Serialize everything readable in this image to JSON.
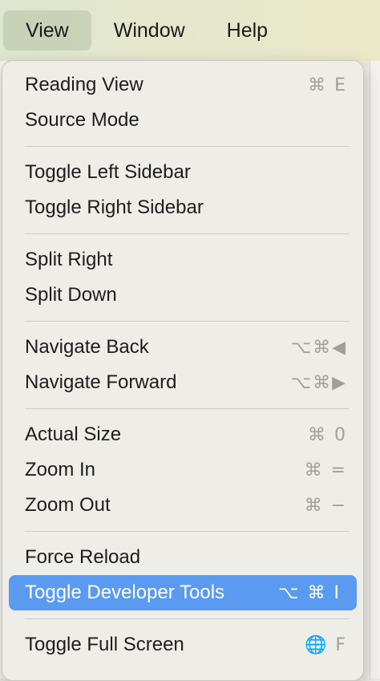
{
  "menubar": {
    "items": [
      {
        "label": "View"
      },
      {
        "label": "Window"
      },
      {
        "label": "Help"
      }
    ]
  },
  "menu": {
    "groups": [
      [
        {
          "label": "Reading View",
          "shortcut": "⌘ E"
        },
        {
          "label": "Source Mode",
          "shortcut": ""
        }
      ],
      [
        {
          "label": "Toggle Left Sidebar",
          "shortcut": ""
        },
        {
          "label": "Toggle Right Sidebar",
          "shortcut": ""
        }
      ],
      [
        {
          "label": "Split Right",
          "shortcut": ""
        },
        {
          "label": "Split Down",
          "shortcut": ""
        }
      ],
      [
        {
          "label": "Navigate Back",
          "shortcut": "⌥⌘◀"
        },
        {
          "label": "Navigate Forward",
          "shortcut": "⌥⌘▶"
        }
      ],
      [
        {
          "label": "Actual Size",
          "shortcut": "⌘ 0"
        },
        {
          "label": "Zoom In",
          "shortcut": "⌘ ="
        },
        {
          "label": "Zoom Out",
          "shortcut": "⌘ −"
        }
      ],
      [
        {
          "label": "Force Reload",
          "shortcut": ""
        },
        {
          "label": "Toggle Developer Tools",
          "shortcut": "⌥ ⌘ I",
          "highlighted": true
        }
      ],
      [
        {
          "label": "Toggle Full Screen",
          "shortcut": "🌐 F"
        }
      ]
    ]
  },
  "colors": {
    "highlight": "#5a9af0",
    "menu_bg": "#efede8"
  }
}
